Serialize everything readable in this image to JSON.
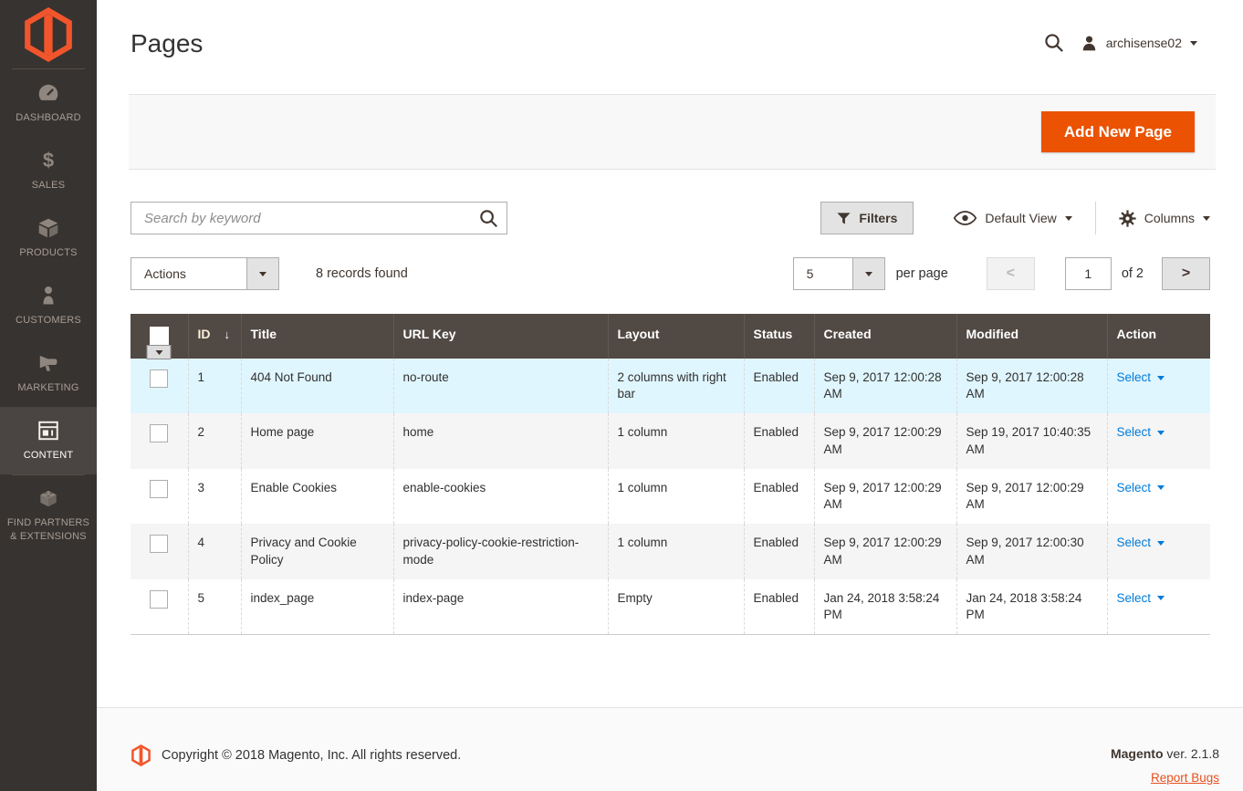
{
  "sidebar": {
    "items": [
      {
        "label": "DASHBOARD",
        "icon": "dashboard-gauge-icon"
      },
      {
        "label": "SALES",
        "icon": "dollar-icon"
      },
      {
        "label": "PRODUCTS",
        "icon": "box-icon"
      },
      {
        "label": "CUSTOMERS",
        "icon": "person-icon"
      },
      {
        "label": "MARKETING",
        "icon": "megaphone-icon"
      },
      {
        "label": "CONTENT",
        "icon": "layout-icon",
        "active": true
      },
      {
        "label": "FIND PARTNERS & EXTENSIONS",
        "icon": "partner-cube-icon"
      }
    ]
  },
  "header": {
    "title": "Pages",
    "username": "archisense02"
  },
  "page_actions": {
    "add_button": "Add New Page"
  },
  "grid_toolbar": {
    "search_placeholder": "Search by keyword",
    "filters_label": "Filters",
    "view_label": "Default View",
    "columns_label": "Columns",
    "actions_label": "Actions",
    "records_found": "8 records found",
    "per_page_value": "5",
    "per_page_label": "per page",
    "page_value": "1",
    "page_total": "of 2"
  },
  "table": {
    "sort_indicator": "↓",
    "columns": [
      "ID",
      "Title",
      "URL Key",
      "Layout",
      "Status",
      "Created",
      "Modified",
      "Action"
    ],
    "action_label": "Select",
    "rows": [
      {
        "id": "1",
        "title": "404 Not Found",
        "url_key": "no-route",
        "layout": "2 columns with right bar",
        "status": "Enabled",
        "created": "Sep 9, 2017 12:00:28 AM",
        "modified": "Sep 9, 2017 12:00:28 AM",
        "action": "Select"
      },
      {
        "id": "2",
        "title": "Home page",
        "url_key": "home",
        "layout": "1 column",
        "status": "Enabled",
        "created": "Sep 9, 2017 12:00:29 AM",
        "modified": "Sep 19, 2017 10:40:35 AM",
        "action": "Select"
      },
      {
        "id": "3",
        "title": "Enable Cookies",
        "url_key": "enable-cookies",
        "layout": "1 column",
        "status": "Enabled",
        "created": "Sep 9, 2017 12:00:29 AM",
        "modified": "Sep 9, 2017 12:00:29 AM",
        "action": "Select"
      },
      {
        "id": "4",
        "title": "Privacy and Cookie Policy",
        "url_key": "privacy-policy-cookie-restriction-mode",
        "layout": "1 column",
        "status": "Enabled",
        "created": "Sep 9, 2017 12:00:29 AM",
        "modified": "Sep 9, 2017 12:00:30 AM",
        "action": "Select"
      },
      {
        "id": "5",
        "title": "index_page",
        "url_key": "index-page",
        "layout": "Empty",
        "status": "Enabled",
        "created": "Jan 24, 2018 3:58:24 PM",
        "modified": "Jan 24, 2018 3:58:24 PM",
        "action": "Select"
      }
    ]
  },
  "footer": {
    "copyright": "Copyright © 2018 Magento, Inc. All rights reserved.",
    "brand": "Magento",
    "version": " ver. 2.1.8",
    "report_bugs": "Report Bugs"
  },
  "colors": {
    "accent_orange": "#eb5202",
    "logo_orange": "#f2552c",
    "link_blue": "#007bdb",
    "sidebar_bg": "#373330",
    "sidebar_active_bg": "#4a4542",
    "table_header_bg": "#514943",
    "row_highlight": "#e0f6fe",
    "row_alt": "#f5f5f5",
    "band_bg": "#f8f8f8"
  }
}
